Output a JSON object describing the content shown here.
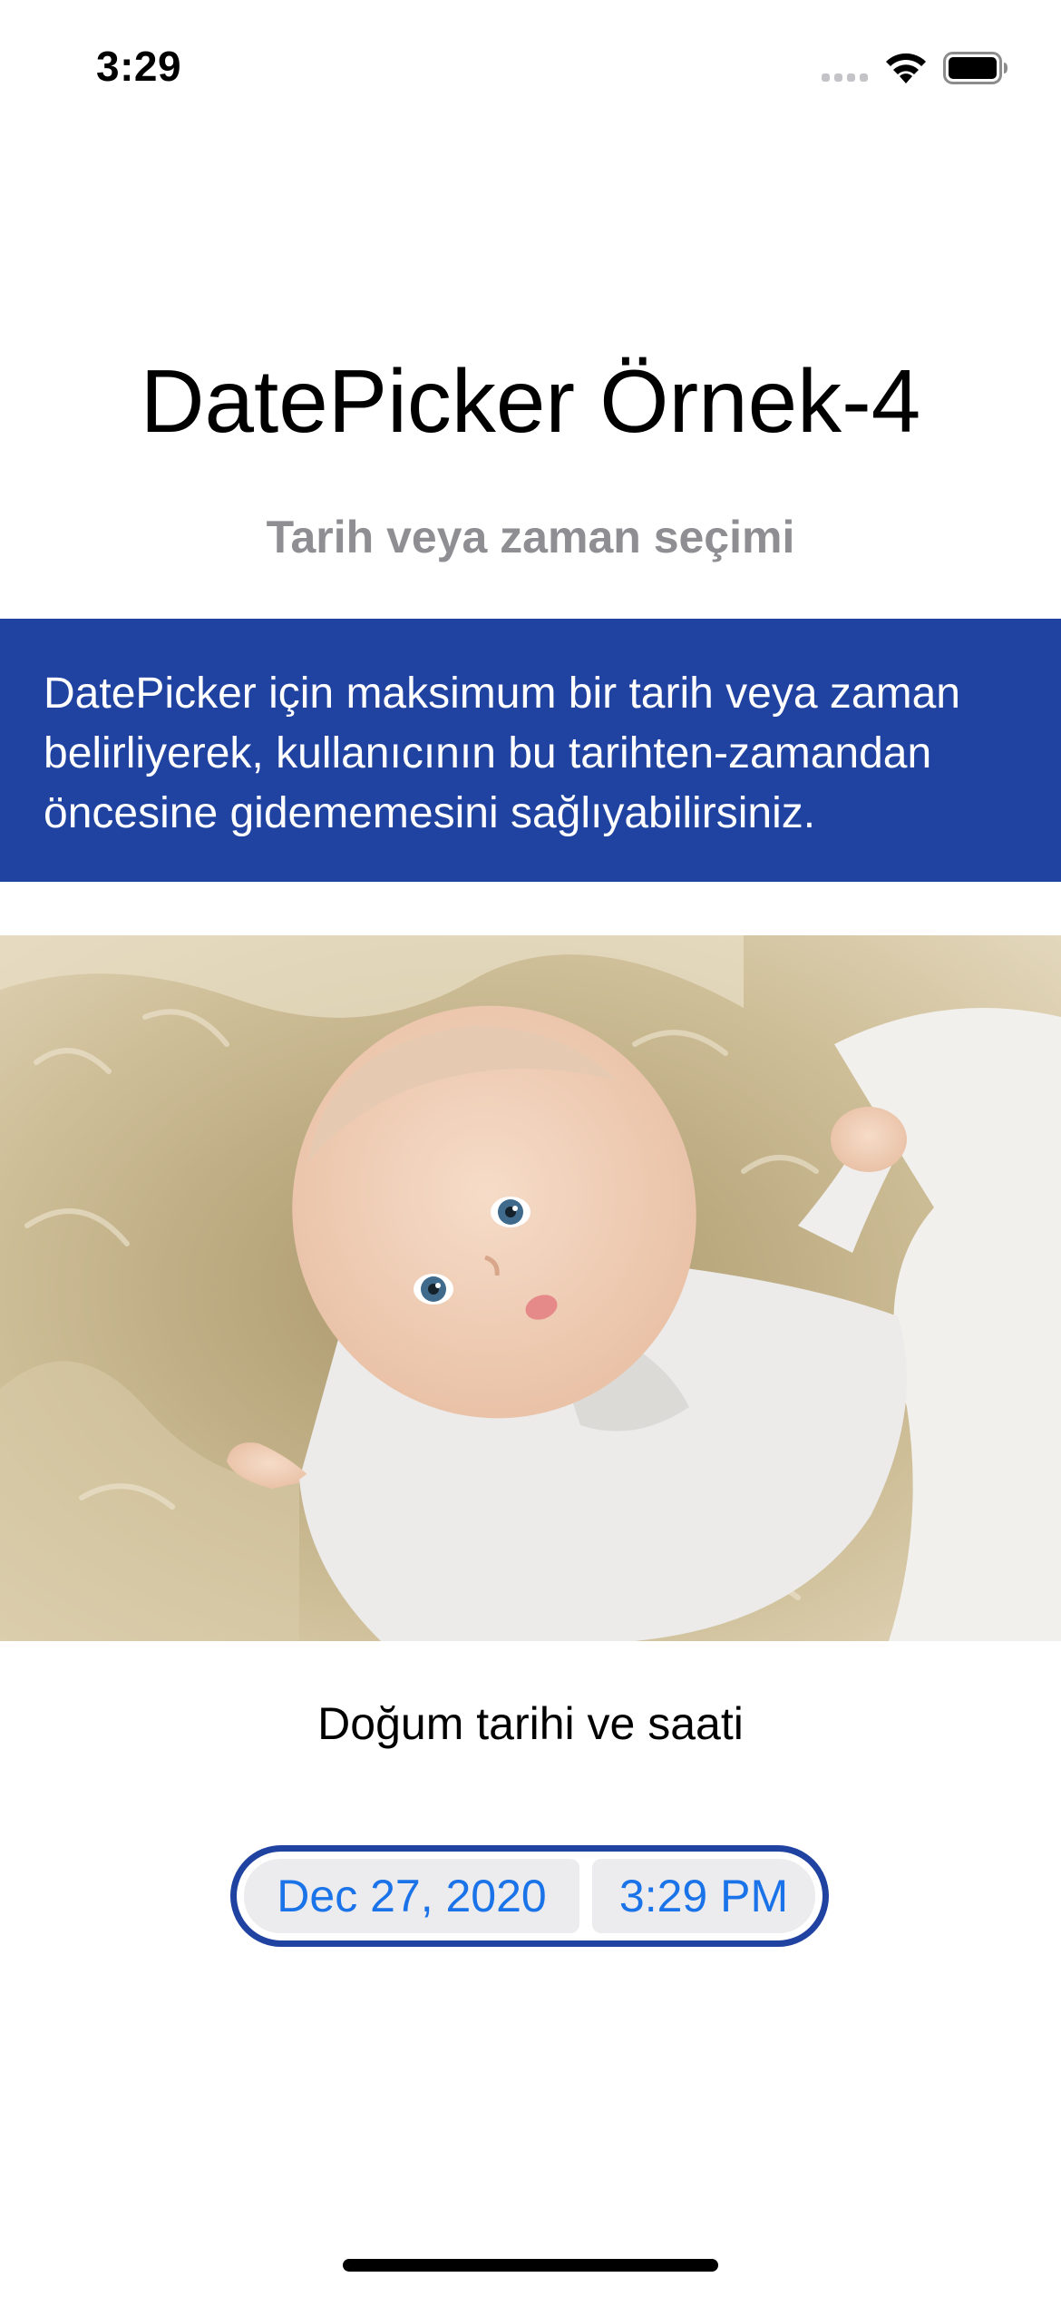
{
  "status_bar": {
    "time": "3:29",
    "signal_icon": "cellular-signal-icon",
    "wifi_icon": "wifi-icon",
    "battery_icon": "battery-icon"
  },
  "header": {
    "title": "DatePicker Örnek-4",
    "subtitle": "Tarih veya zaman seçimi"
  },
  "info_banner": {
    "text": "DatePicker için maksimum bir tarih veya zaman belirliyerek, kullanıcının bu tarihten-zamandan öncesine gidememesini sağlıyabilirsiniz.",
    "background": "#2042a0"
  },
  "form": {
    "label": "Doğum tarihi ve saati",
    "date_value": "Dec 27, 2020",
    "time_value": "3:29 PM",
    "accent": "#1a73e8",
    "border": "#2042a0"
  }
}
